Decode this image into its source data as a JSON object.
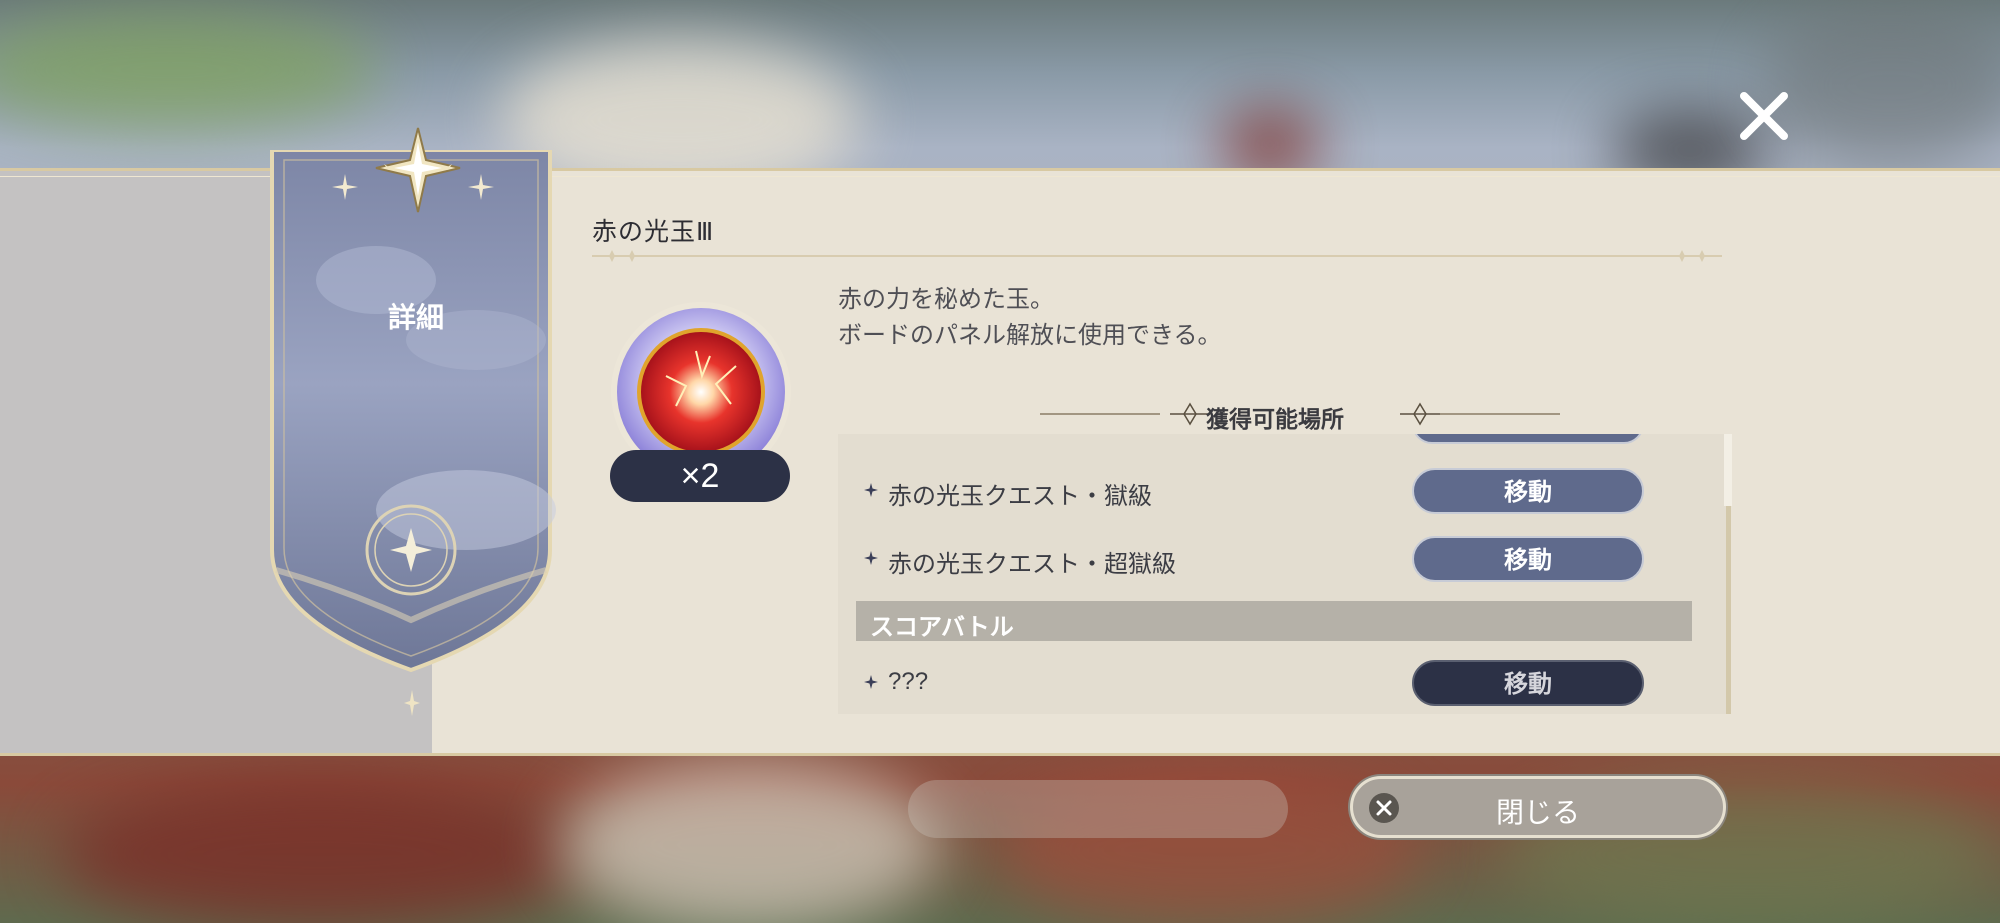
{
  "item": {
    "title": "赤の光玉Ⅲ",
    "quantity": "×2",
    "description_line1": "赤の力を秘めた玉。",
    "description_line2": "ボードのパネル解放に使用できる。"
  },
  "tab": {
    "label": "詳細"
  },
  "sources": {
    "heading": "獲得可能場所",
    "rows": [
      {
        "label": "赤の光玉クエスト・獄級",
        "button": "移動"
      },
      {
        "label": "赤の光玉クエスト・超獄級",
        "button": "移動"
      }
    ],
    "section": "スコアバトル",
    "section_rows": [
      {
        "label": "???",
        "button": "移動"
      }
    ]
  },
  "footer": {
    "close_label": "閉じる"
  },
  "colors": {
    "panel": "#e9e3d6",
    "button_active": "#5f6a8c",
    "button_dark": "#2c3146",
    "gold": "#d8c9a2"
  },
  "icons": [
    "close-icon",
    "compass-star-icon",
    "red-orb-icon",
    "sparkle-icon"
  ]
}
